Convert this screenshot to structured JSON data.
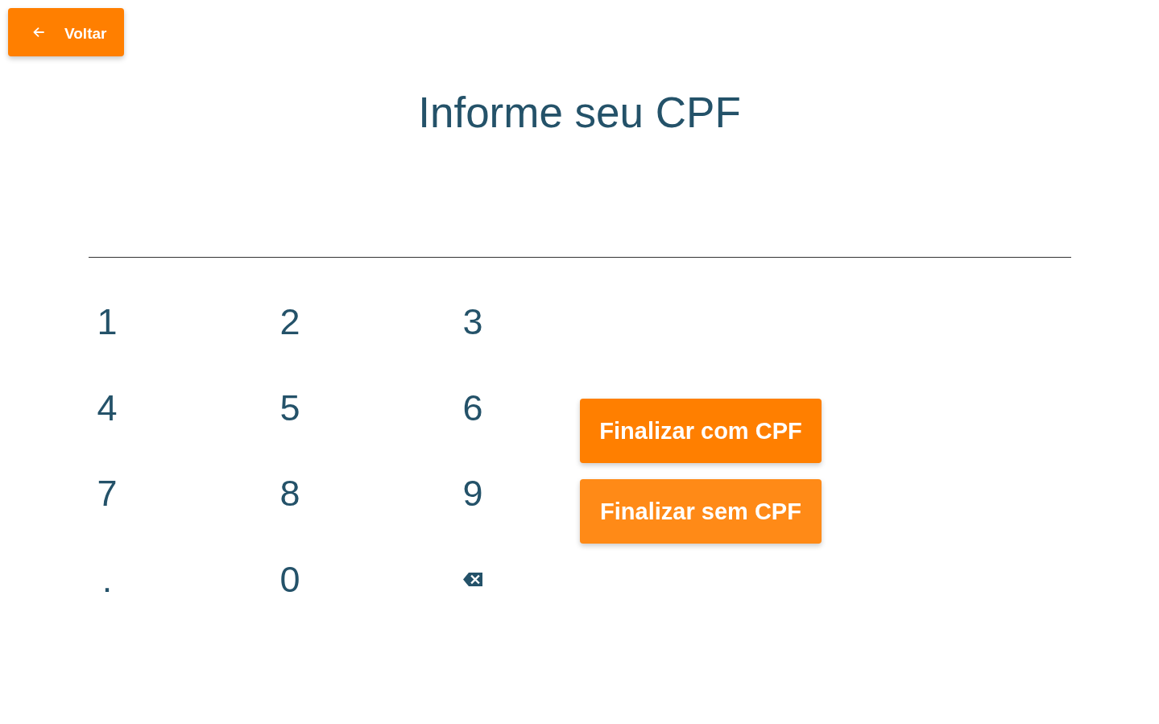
{
  "back_button": {
    "label": "Voltar"
  },
  "title": "Informe seu CPF",
  "keypad": [
    {
      "kind": "key",
      "label": "1"
    },
    {
      "kind": "key",
      "label": "2"
    },
    {
      "kind": "key",
      "label": "3"
    },
    {
      "kind": "key",
      "label": "4"
    },
    {
      "kind": "key",
      "label": "5"
    },
    {
      "kind": "key",
      "label": "6"
    },
    {
      "kind": "key",
      "label": "7"
    },
    {
      "kind": "key",
      "label": "8"
    },
    {
      "kind": "key",
      "label": "9"
    },
    {
      "kind": "key",
      "label": "."
    },
    {
      "kind": "key",
      "label": "0"
    },
    {
      "kind": "backspace"
    }
  ],
  "actions": [
    {
      "label": "Finalizar com CPF",
      "color": "#ff7f00"
    },
    {
      "label": "Finalizar sem CPF",
      "color": "#ff8a17"
    }
  ]
}
